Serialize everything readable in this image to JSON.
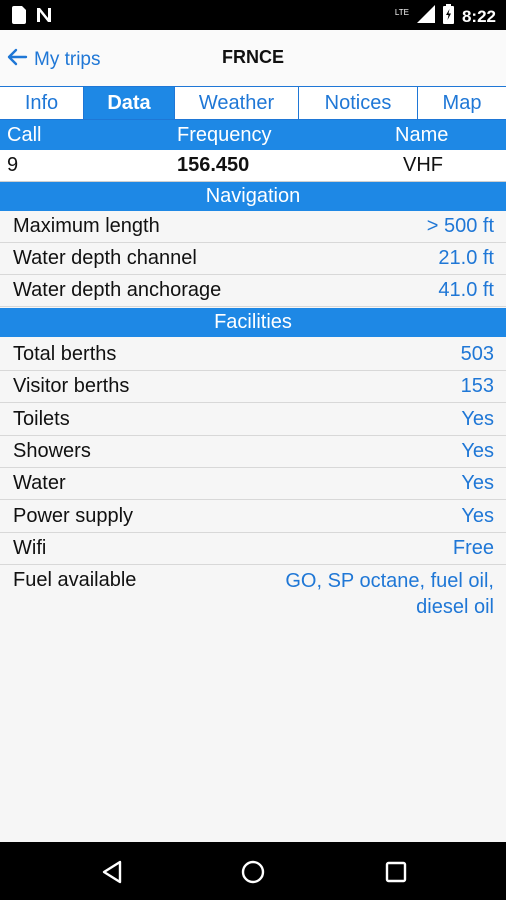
{
  "status_bar": {
    "time": "8:22",
    "network": "LTE",
    "icons": [
      "sim-card-icon",
      "n-app-icon",
      "signal-icon",
      "battery-icon"
    ]
  },
  "header": {
    "back_label": "My trips",
    "title": "FRNCE"
  },
  "tabs": [
    {
      "label": "Info",
      "active": false
    },
    {
      "label": "Data",
      "active": true
    },
    {
      "label": "Weather",
      "active": false
    },
    {
      "label": "Notices",
      "active": false
    },
    {
      "label": "Map",
      "active": false
    }
  ],
  "call_table": {
    "headers": {
      "call": "Call",
      "frequency": "Frequency",
      "name": "Name"
    },
    "row": {
      "call": "9",
      "frequency": "156.450",
      "name": "VHF"
    }
  },
  "navigation": {
    "title": "Navigation",
    "rows": [
      {
        "label": "Maximum length",
        "value": "> 500 ft"
      },
      {
        "label": "Water depth channel",
        "value": "21.0 ft"
      },
      {
        "label": "Water depth anchorage",
        "value": "41.0 ft"
      }
    ]
  },
  "facilities": {
    "title": "Facilities",
    "rows": [
      {
        "label": "Total berths",
        "value": "503"
      },
      {
        "label": "Visitor berths",
        "value": "153"
      },
      {
        "label": "Toilets",
        "value": "Yes"
      },
      {
        "label": "Showers",
        "value": "Yes"
      },
      {
        "label": "Water",
        "value": "Yes"
      },
      {
        "label": "Power supply",
        "value": "Yes"
      },
      {
        "label": "Wifi",
        "value": "Free"
      }
    ],
    "fuel": {
      "label": "Fuel available",
      "value_line1": "GO, SP octane, fuel oil,",
      "value_line2": "diesel oil"
    }
  },
  "colors": {
    "accent": "#1e88e5",
    "link": "#1f77d6",
    "background": "#f6f6f6"
  }
}
